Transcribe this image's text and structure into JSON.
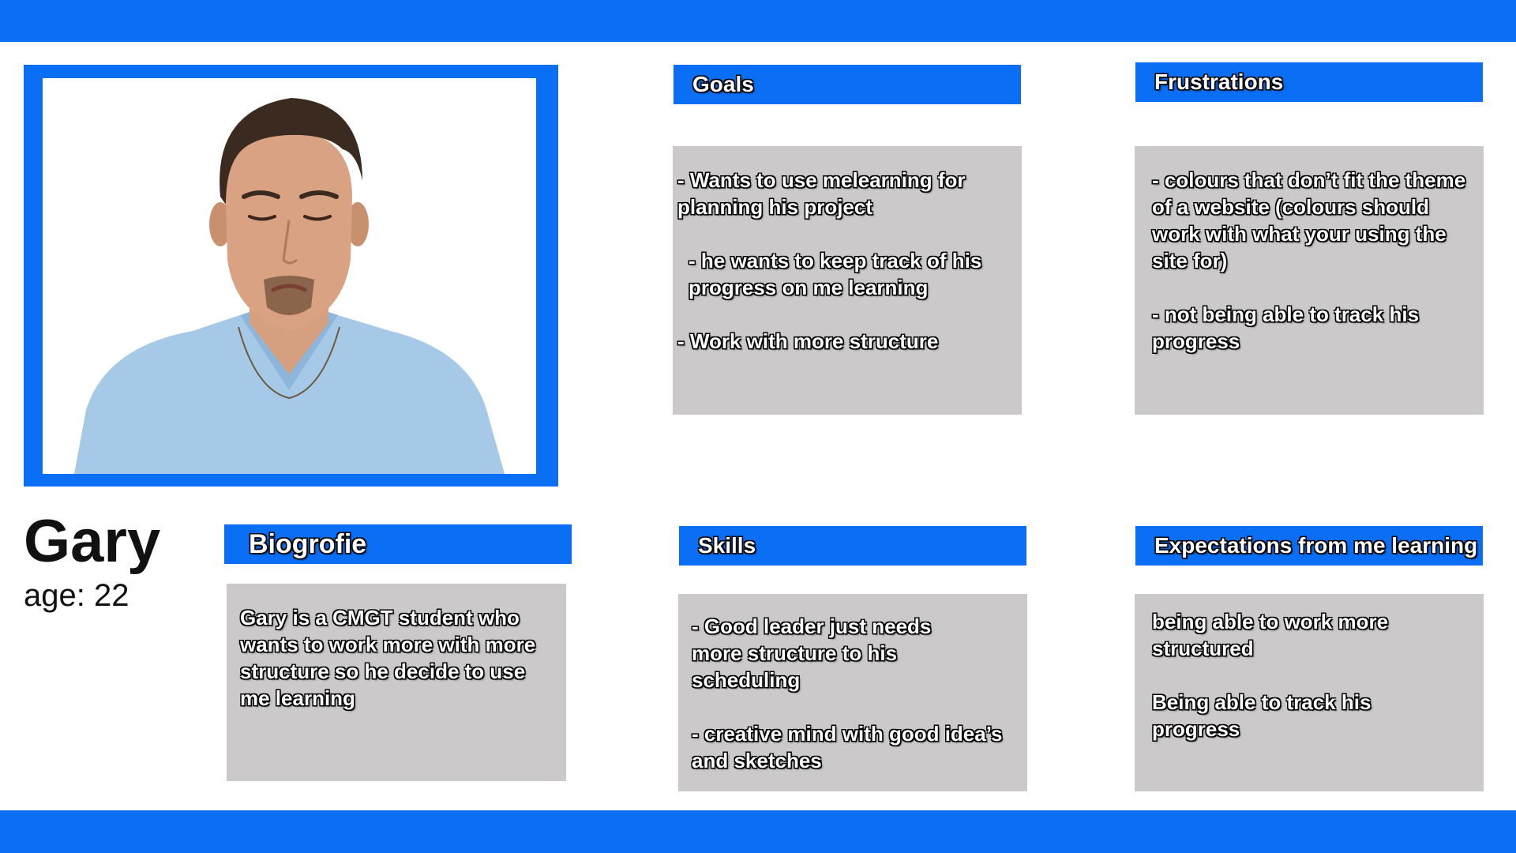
{
  "colors": {
    "accent": "#0a6ff5",
    "box": "#ccc9ca"
  },
  "persona": {
    "name": "Gary",
    "age": "age: 22",
    "photo_icon": "sad-man-photo"
  },
  "sections": {
    "goals": {
      "title": "Goals",
      "items": [
        "- Wants to use melearning for planning his project",
        "- he wants to keep track of his progress on me learning",
        "- Work with more structure"
      ]
    },
    "frustrations": {
      "title": "Frustrations",
      "items": [
        "- colours that don’t fit the theme of a website (colours should work with what your using the site for)",
        "- not being able to track his progress"
      ]
    },
    "biography": {
      "title": "Biogrofie",
      "text": "Gary is a CMGT student who wants to work more with more structure so he decide to use me learning"
    },
    "skills": {
      "title": "Skills",
      "items": [
        "- Good leader just needs more structure to his scheduling",
        "- creative mind with good idea’s and sketches"
      ]
    },
    "expectations": {
      "title": "Expectations from me learning",
      "items": [
        "being able to work more structured",
        "Being able to track his progress"
      ]
    }
  }
}
